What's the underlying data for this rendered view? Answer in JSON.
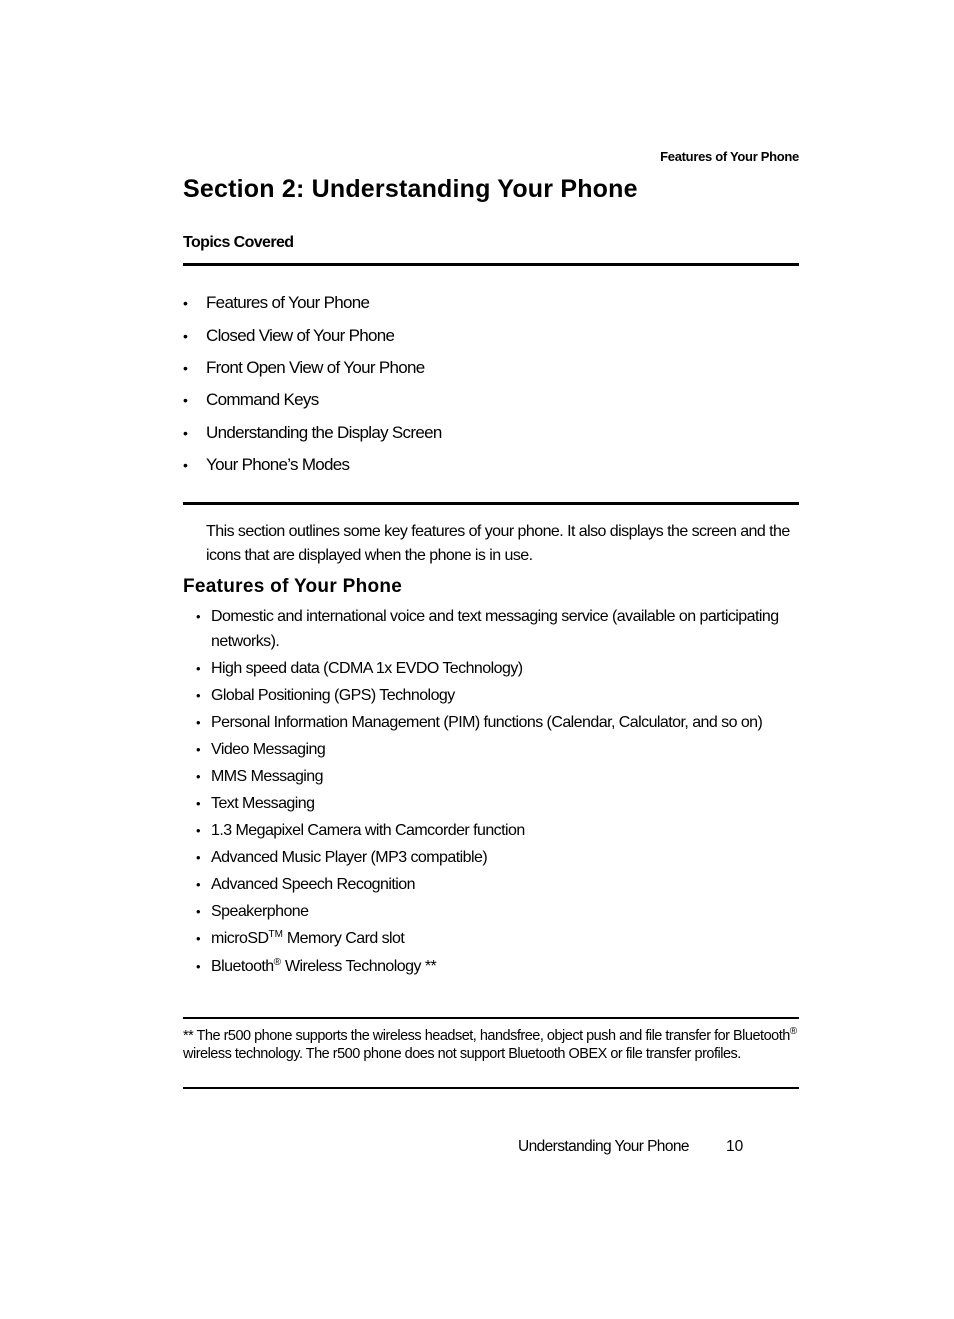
{
  "running_head": "Features of Your Phone",
  "section_title": "Section 2:  Understanding Your Phone",
  "topics": {
    "heading": "Topics Covered",
    "bullet": "•",
    "items": [
      "Features of Your Phone",
      "Closed View of Your Phone",
      "Front Open View of Your Phone",
      "Command Keys",
      "Understanding the Display Screen",
      "Your Phone’s Modes"
    ]
  },
  "intro": "This section outlines some key features of your phone. It also displays the screen and the icons that are displayed when the phone is in use.",
  "features": {
    "heading": "Features of Your Phone",
    "bullet": "•",
    "items": [
      "Domestic and international voice and text messaging service (available on participating networks).",
      "High speed data (CDMA 1x EVDO Technology)",
      "Global Positioning (GPS) Technology",
      "Personal Information Management (PIM) functions (Calendar, Calculator, and so on)",
      "Video Messaging",
      "MMS Messaging",
      "Text Messaging",
      "1.3 Megapixel Camera with Camcorder function",
      "Advanced Music Player (MP3 compatible)",
      "Advanced Speech Recognition",
      "Speakerphone"
    ],
    "microsd": {
      "pre": "microSD",
      "sup": "TM",
      "post": " Memory Card slot"
    },
    "bluetooth": {
      "pre": "Bluetooth",
      "sup": "®",
      "post": " Wireless Technology **"
    }
  },
  "footnote": {
    "part1": "** The r500 phone supports the wireless headset, handsfree, object push and file transfer for Bluetooth",
    "sup": "®",
    "part2": " wireless technology. The r500 phone does not support Bluetooth OBEX or file transfer profiles."
  },
  "footer": {
    "title": "Understanding Your Phone",
    "page_number": "10"
  }
}
